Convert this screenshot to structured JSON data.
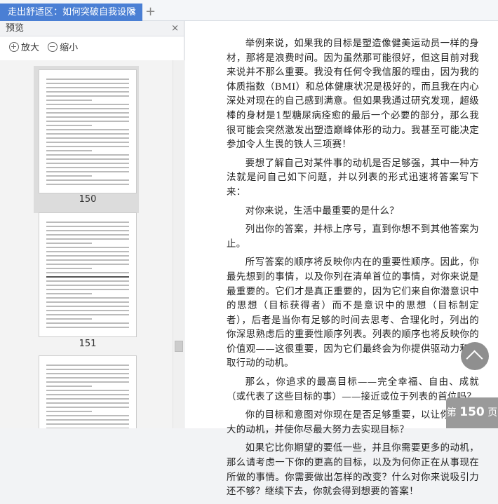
{
  "tab": {
    "title": "走出舒适区：如何突破自我设限",
    "close": "×",
    "new_tab": "+"
  },
  "sidebar": {
    "title": "预览",
    "close": "×",
    "zoom_in": "放大",
    "zoom_out": "缩小",
    "pages": [
      "150",
      "151"
    ]
  },
  "content": {
    "paragraphs": [
      "举例来说，如果我的目标是塑造像健美运动员一样的身材，那将是浪费时间。因为虽然那可能很好，但这目前对我来说并不那么重要。我没有任何令我信服的理由，因为我的体质指数（BMI）和总体健康状况是极好的，而且我在内心深处对现在的自己感到满意。但如果我通过研究发现，超级棒的身材是1型糖尿病痊愈的最后一个必要的部分，那么我很可能会突然激发出塑造巅峰体形的动力。我甚至可能决定参加令人生畏的铁人三项赛！",
      "要想了解自己对某件事的动机是否足够强，其中一种方法就是问自己如下问题，并以列表的形式迅速将答案写下来：",
      "对你来说，生活中最重要的是什么？",
      "列出你的答案，并标上序号，直到你想不到其他答案为止。",
      "所写答案的顺序将反映你内在的重要性顺序。因此，你最先想到的事情，以及你列在清单首位的事情，对你来说是最重要的。它们才是真正重要的，因为它们来自你潜意识中的思想（目标获得者）而不是意识中的思想（目标制定者），后者是当你有足够的时间去思考、合理化时，列出的你深思熟虑后的重要性顺序列表。列表的顺序也将反映你的价值观——这很重要，因为它们最终会为你提供驱动力和采取行动的动机。",
      "那么，你追求的最高目标——完全幸福、自由、成就（或代表了这些目标的事）——接近或位于列表的首位吗？",
      "你的目标和意图对你现在是否足够重要，以让你保持强大的动机，并使你尽最大努力去实现目标？",
      "如果它比你期望的要低一些，并且你需要更多的动机，那么请考虑一下你的更高的目标，以及为何你正在从事现在所做的事情。你需要做出怎样的改变？什么对你来说吸引力还不够？继续下去，你就会得到想要的答案！"
    ]
  },
  "page_indicator": {
    "prefix": "第",
    "number": "150",
    "suffix": "页"
  }
}
